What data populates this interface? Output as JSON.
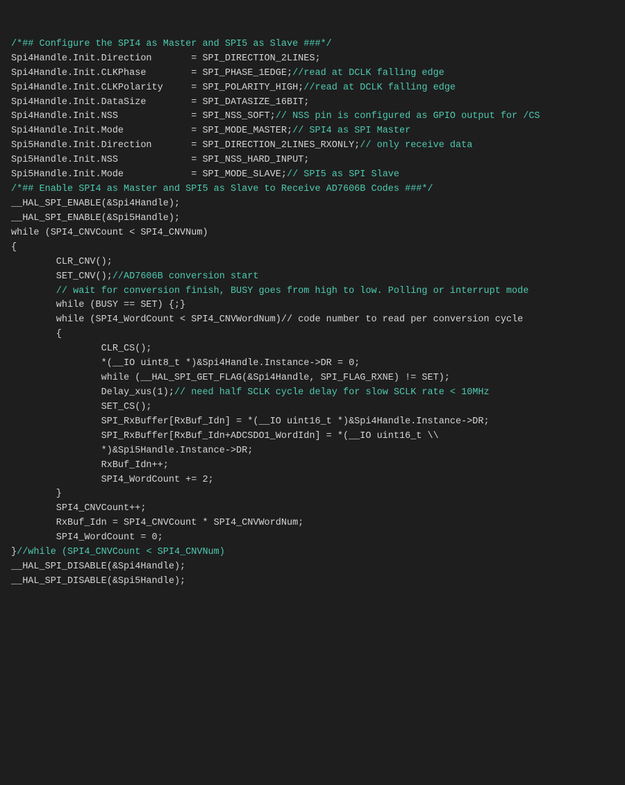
{
  "code": {
    "lines": [
      {
        "type": "comment",
        "text": "/*## Configure the SPI4 as Master and SPI5 as Slave ###*/"
      },
      {
        "type": "mixed",
        "parts": [
          {
            "t": "plain",
            "v": "Spi4Handle.Init.Direction       = SPI_DIRECTION_2LINES;"
          }
        ]
      },
      {
        "type": "mixed",
        "parts": [
          {
            "t": "plain",
            "v": "Spi4Handle.Init.CLKPhase        = SPI_PHASE_1EDGE;"
          },
          {
            "t": "comment",
            "v": "//read at DCLK falling edge"
          }
        ]
      },
      {
        "type": "mixed",
        "parts": [
          {
            "t": "plain",
            "v": "Spi4Handle.Init.CLKPolarity     = SPI_POLARITY_HIGH;"
          },
          {
            "t": "comment",
            "v": "//read at DCLK falling edge"
          }
        ]
      },
      {
        "type": "mixed",
        "parts": [
          {
            "t": "plain",
            "v": "Spi4Handle.Init.DataSize        = SPI_DATASIZE_16BIT;"
          }
        ]
      },
      {
        "type": "mixed",
        "parts": [
          {
            "t": "plain",
            "v": "Spi4Handle.Init.NSS             = SPI_NSS_SOFT;"
          },
          {
            "t": "comment",
            "v": "// NSS pin is configured as GPIO output for /CS"
          }
        ]
      },
      {
        "type": "mixed",
        "parts": [
          {
            "t": "plain",
            "v": "Spi4Handle.Init.Mode            = SPI_MODE_MASTER;"
          },
          {
            "t": "comment",
            "v": "// SPI4 as SPI Master"
          }
        ]
      },
      {
        "type": "mixed",
        "parts": [
          {
            "t": "plain",
            "v": "Spi5Handle.Init.Direction       = SPI_DIRECTION_2LINES_RXONLY;"
          },
          {
            "t": "comment",
            "v": "// only receive data"
          }
        ]
      },
      {
        "type": "mixed",
        "parts": [
          {
            "t": "plain",
            "v": "Spi5Handle.Init.NSS             = SPI_NSS_HARD_INPUT;"
          }
        ]
      },
      {
        "type": "mixed",
        "parts": [
          {
            "t": "plain",
            "v": "Spi5Handle.Init.Mode            = SPI_MODE_SLAVE;"
          },
          {
            "t": "comment",
            "v": "// SPI5 as SPI Slave"
          }
        ]
      },
      {
        "type": "comment",
        "text": "/*## Enable SPI4 as Master and SPI5 as Slave to Receive AD7606B Codes ###*/"
      },
      {
        "type": "plain",
        "text": "__HAL_SPI_ENABLE(&Spi4Handle);"
      },
      {
        "type": "plain",
        "text": ""
      },
      {
        "type": "plain",
        "text": "__HAL_SPI_ENABLE(&Spi5Handle);"
      },
      {
        "type": "plain",
        "text": "while (SPI4_CNVCount < SPI4_CNVNum)"
      },
      {
        "type": "plain",
        "text": "{"
      },
      {
        "type": "plain",
        "text": ""
      },
      {
        "type": "plain",
        "text": "        CLR_CNV();"
      },
      {
        "type": "mixed",
        "parts": [
          {
            "t": "plain",
            "v": "        SET_CNV();"
          },
          {
            "t": "comment",
            "v": "//AD7606B conversion start"
          }
        ]
      },
      {
        "type": "comment",
        "text": "        // wait for conversion finish, BUSY goes from high to low. Polling or interrupt mode"
      },
      {
        "type": "plain",
        "text": "        while (BUSY == SET) {;}"
      },
      {
        "type": "plain",
        "text": "        while (SPI4_WordCount < SPI4_CNVWordNum)// code number to read per conversion cycle"
      },
      {
        "type": "plain",
        "text": "        {"
      },
      {
        "type": "plain",
        "text": ""
      },
      {
        "type": "plain",
        "text": "                CLR_CS();"
      },
      {
        "type": "plain",
        "text": "                *(__IO uint8_t *)&Spi4Handle.Instance->DR = 0;"
      },
      {
        "type": "plain",
        "text": "                while (__HAL_SPI_GET_FLAG(&Spi4Handle, SPI_FLAG_RXNE) != SET);"
      },
      {
        "type": "mixed",
        "parts": [
          {
            "t": "plain",
            "v": "                Delay_xus(1);"
          },
          {
            "t": "comment",
            "v": "// need half SCLK cycle delay for slow SCLK rate < 10MHz"
          }
        ]
      },
      {
        "type": "plain",
        "text": "                SET_CS();"
      },
      {
        "type": "plain",
        "text": "                SPI_RxBuffer[RxBuf_Idn] = *(__IO uint16_t *)&Spi4Handle.Instance->DR;"
      },
      {
        "type": "plain",
        "text": "                SPI_RxBuffer[RxBuf_Idn+ADCSDO1_WordIdn] = *(__IO uint16_t \\\\"
      },
      {
        "type": "plain",
        "text": "                *)&Spi5Handle.Instance->DR;"
      },
      {
        "type": "plain",
        "text": "                RxBuf_Idn++;"
      },
      {
        "type": "plain",
        "text": "                SPI4_WordCount += 2;"
      },
      {
        "type": "plain",
        "text": "        }"
      },
      {
        "type": "plain",
        "text": "        SPI4_CNVCount++;"
      },
      {
        "type": "plain",
        "text": ""
      },
      {
        "type": "plain",
        "text": "        RxBuf_Idn = SPI4_CNVCount * SPI4_CNVWordNum;"
      },
      {
        "type": "plain",
        "text": "        SPI4_WordCount = 0;"
      },
      {
        "type": "mixed",
        "parts": [
          {
            "t": "plain",
            "v": "}"
          },
          {
            "t": "comment",
            "v": "//while (SPI4_CNVCount < SPI4_CNVNum)"
          }
        ]
      },
      {
        "type": "plain",
        "text": "__HAL_SPI_DISABLE(&Spi4Handle);"
      },
      {
        "type": "plain",
        "text": ""
      },
      {
        "type": "plain",
        "text": "__HAL_SPI_DISABLE(&Spi5Handle);"
      }
    ]
  }
}
